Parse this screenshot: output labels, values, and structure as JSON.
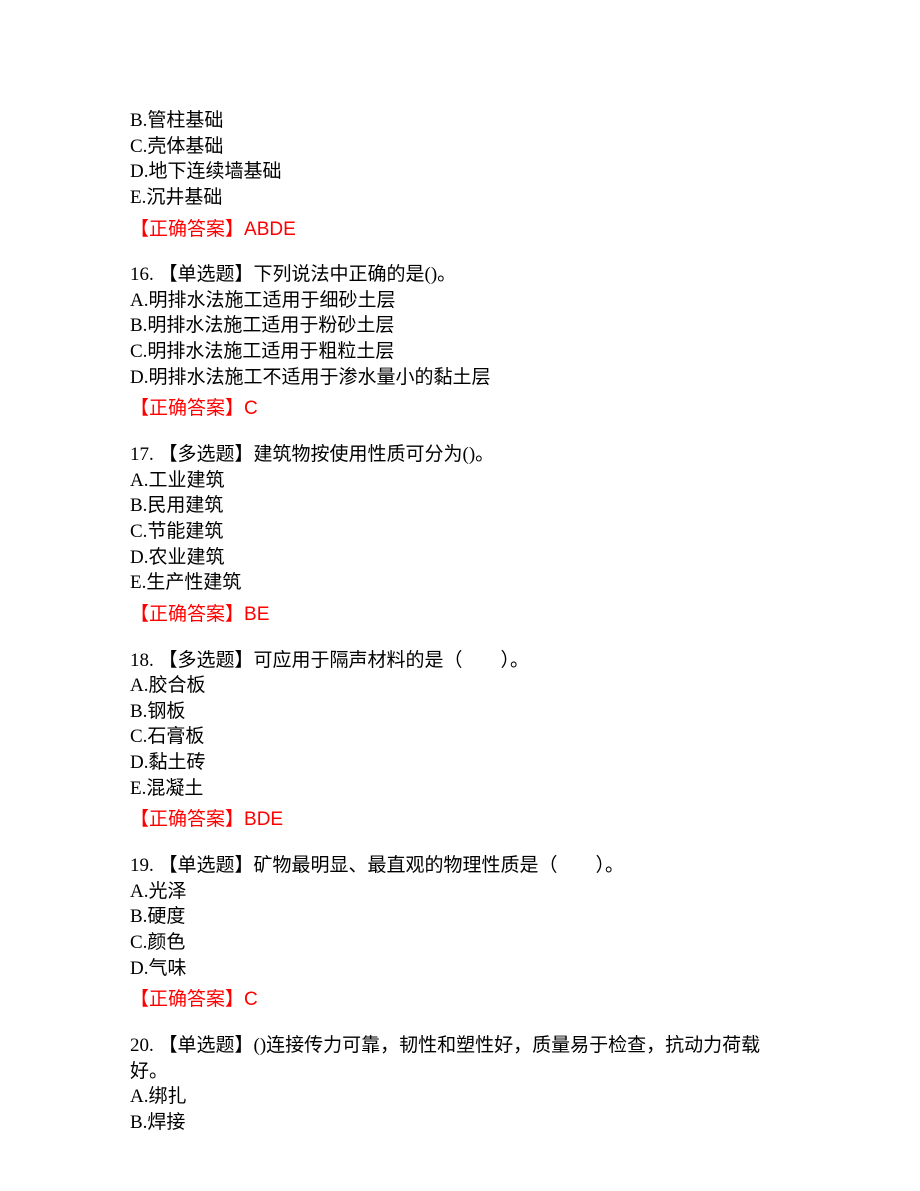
{
  "q15_remainder": {
    "options": [
      "B.管柱基础",
      "C.壳体基础",
      "D.地下连续墙基础",
      "E.沉井基础"
    ],
    "answer_label": "【正确答案】",
    "answer_value": "ABDE"
  },
  "q16": {
    "stem": "16. 【单选题】下列说法中正确的是()。",
    "options": [
      "A.明排水法施工适用于细砂土层",
      "B.明排水法施工适用于粉砂土层",
      "C.明排水法施工适用于粗粒土层",
      "D.明排水法施工不适用于渗水量小的黏土层"
    ],
    "answer_label": "【正确答案】",
    "answer_value": "C"
  },
  "q17": {
    "stem": "17. 【多选题】建筑物按使用性质可分为()。",
    "options": [
      "A.工业建筑",
      "B.民用建筑",
      "C.节能建筑",
      "D.农业建筑",
      "E.生产性建筑"
    ],
    "answer_label": "【正确答案】",
    "answer_value": "BE"
  },
  "q18": {
    "stem": "18. 【多选题】可应用于隔声材料的是（　　）。",
    "options": [
      "A.胶合板",
      "B.钢板",
      "C.石膏板",
      "D.黏土砖",
      "E.混凝土"
    ],
    "answer_label": "【正确答案】",
    "answer_value": "BDE"
  },
  "q19": {
    "stem": "19. 【单选题】矿物最明显、最直观的物理性质是（　　）。",
    "options": [
      "A.光泽",
      "B.硬度",
      "C.颜色",
      "D.气味"
    ],
    "answer_label": "【正确答案】",
    "answer_value": "C"
  },
  "q20": {
    "stem": "20. 【单选题】()连接传力可靠，韧性和塑性好，质量易于检查，抗动力荷载好。",
    "options": [
      "A.绑扎",
      "B.焊接"
    ]
  }
}
